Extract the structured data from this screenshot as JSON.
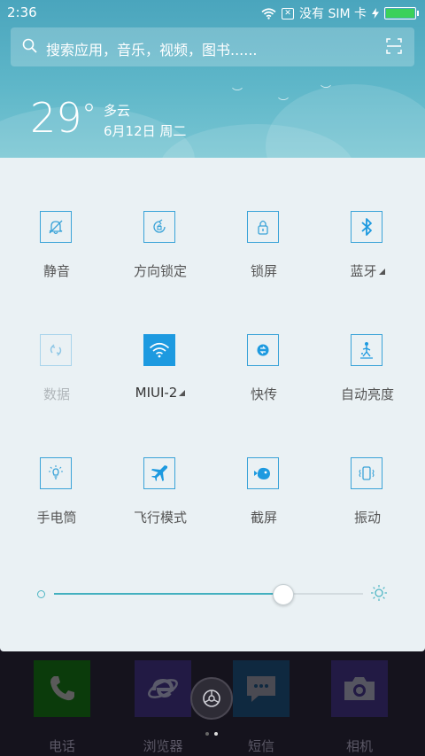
{
  "status": {
    "time": "2:36",
    "sim": "没有 SIM 卡",
    "icons": [
      "wifi-icon",
      "no-sim-icon",
      "charging-icon",
      "battery-icon"
    ]
  },
  "search": {
    "placeholder": "搜索应用，音乐，视频，图书......"
  },
  "weather": {
    "temp": "29",
    "degree": "°",
    "condition": "多云",
    "date": "6月12日 周二"
  },
  "toggles": [
    {
      "label": "静音",
      "icon": "bell-off-icon"
    },
    {
      "label": "方向锁定",
      "icon": "rotation-lock-icon"
    },
    {
      "label": "锁屏",
      "icon": "lock-icon"
    },
    {
      "label": "蓝牙",
      "icon": "bluetooth-icon"
    },
    {
      "label": "数据",
      "icon": "data-icon"
    },
    {
      "label": "MIUI-2",
      "icon": "wifi-icon"
    },
    {
      "label": "快传",
      "icon": "transfer-icon"
    },
    {
      "label": "自动亮度",
      "icon": "auto-brightness-icon"
    },
    {
      "label": "手电筒",
      "icon": "flashlight-icon"
    },
    {
      "label": "飞行模式",
      "icon": "airplane-icon"
    },
    {
      "label": "截屏",
      "icon": "screenshot-icon"
    },
    {
      "label": "振动",
      "icon": "vibrate-icon"
    }
  ],
  "brightness": {
    "level": 0.74
  },
  "dock": [
    {
      "label": "电话",
      "icon": "phone-icon",
      "color": "#0b3b0b"
    },
    {
      "label": "浏览器",
      "icon": "browser-icon",
      "color": "#221a44"
    },
    {
      "label": "短信",
      "icon": "sms-icon",
      "color": "#0f2940"
    },
    {
      "label": "相机",
      "icon": "camera-icon",
      "color": "#221a44"
    }
  ],
  "colors": {
    "accent": "#1d9ae0",
    "panel": "#eaf1f4",
    "header": "#5fb7c9"
  }
}
